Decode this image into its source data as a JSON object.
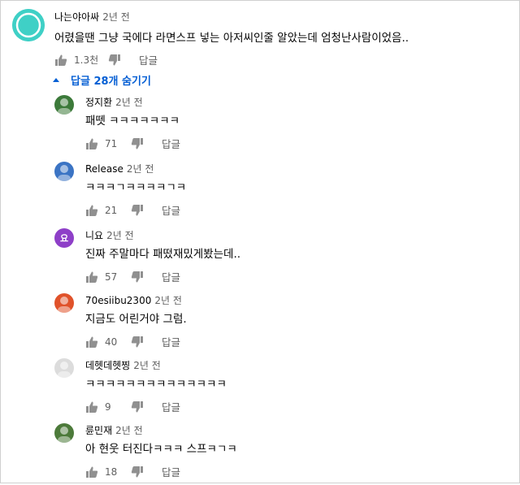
{
  "top": {
    "author": "나는야아싸",
    "time": "2년 전",
    "text": "어렸을땐 그냥 국에다 라면스프 넣는 아저씨인줄 알았는데 엄청난사람이었음..",
    "likes": "1.3천",
    "reply_label": "답글"
  },
  "toggle_label": "답글 28개 숨기기",
  "replies": [
    {
      "author": "정지환",
      "time": "2년 전",
      "text": "패뗏 ㅋㅋㅋㅋㅋㅋㅋ",
      "likes": "71",
      "reply_label": "답글",
      "avatar_color": "#3c7a3a"
    },
    {
      "author": "Release",
      "time": "2년 전",
      "text": "ㅋㅋㅋㄱㅋㅋㅋㅋㄱㅋ",
      "likes": "21",
      "reply_label": "답글",
      "avatar_color": "#3b74c4"
    },
    {
      "author": "니요",
      "time": "2년 전",
      "text": "진짜 주말마다 패떴재밌게봤는데..",
      "likes": "57",
      "reply_label": "답글",
      "avatar_letter": "요",
      "avatar_color": "#8e3fc8"
    },
    {
      "author": "70esiibu2300",
      "time": "2년 전",
      "text": "지금도 어린거야 그럼.",
      "likes": "40",
      "reply_label": "답글",
      "avatar_color": "#e0522a"
    },
    {
      "author": "데헷데헷찡",
      "time": "2년 전",
      "text": "ㅋㅋㅋㅋㅋㅋㅋㅋㅋㅋㅋㅋㅋㅋ",
      "likes": "9",
      "reply_label": "답글",
      "avatar_color": "#dcdcdc"
    },
    {
      "author": "륜민재",
      "time": "2년 전",
      "text": "아 현웃 터진다ㅋㅋㅋ 스프ㅋㄱㅋ",
      "likes": "18",
      "reply_label": "답글",
      "avatar_color": "#4c7a3a"
    }
  ],
  "colors": {
    "link": "#065fd4",
    "secondary": "#606060",
    "top_avatar": "#3fd0c6"
  }
}
